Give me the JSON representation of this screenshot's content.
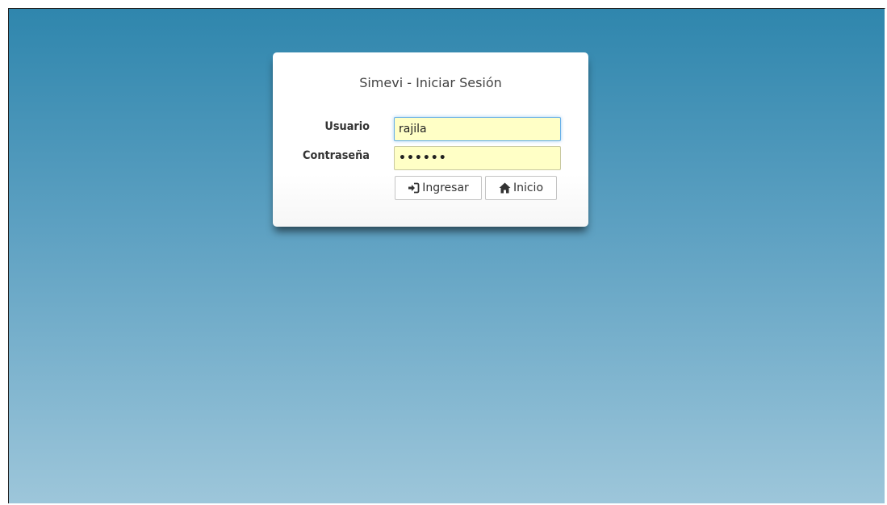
{
  "login": {
    "title": "Simevi - Iniciar Sesión",
    "user_label": "Usuario",
    "user_value": "rajila",
    "password_label": "Contraseña",
    "password_value": "••••••",
    "submit_label": "Ingresar",
    "submit_icon": "login-icon",
    "home_label": "Inicio",
    "home_icon": "home-icon"
  },
  "colors": {
    "background_top": "#2f86ad",
    "background_bottom": "#9dc6da",
    "input_autofill": "#ffffc6",
    "focus_border": "#66afe9"
  }
}
